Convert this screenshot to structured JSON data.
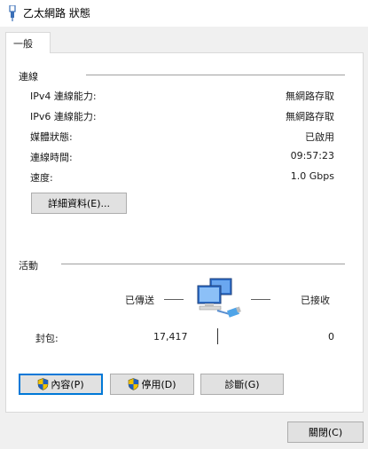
{
  "window": {
    "title": "乙太網路 狀態",
    "icon": "ethernet-plug-icon"
  },
  "tabs": [
    {
      "label": "一般"
    }
  ],
  "connection": {
    "heading": "連線",
    "rows": [
      {
        "label": "IPv4 連線能力:",
        "value": "無網路存取"
      },
      {
        "label": "IPv6 連線能力:",
        "value": "無網路存取"
      },
      {
        "label": "媒體狀態:",
        "value": "已啟用"
      },
      {
        "label": "連線時間:",
        "value": "09:57:23"
      },
      {
        "label": "速度:",
        "value": "1.0 Gbps"
      }
    ],
    "details_button": "詳細資料(E)..."
  },
  "activity": {
    "heading": "活動",
    "sent_label": "已傳送",
    "received_label": "已接收",
    "packets_label": "封包:",
    "packets_sent": "17,417",
    "packets_received": "0",
    "network_icon": "network-computers-icon"
  },
  "actions": {
    "properties": "內容(P)",
    "disable": "停用(D)",
    "diagnose": "診斷(G)"
  },
  "footer": {
    "close": "關閉(C)"
  },
  "colors": {
    "focus_border": "#0078d7",
    "button_bg": "#e1e1e1",
    "shield_blue": "#1f5fbf",
    "shield_yellow": "#f2c200"
  }
}
